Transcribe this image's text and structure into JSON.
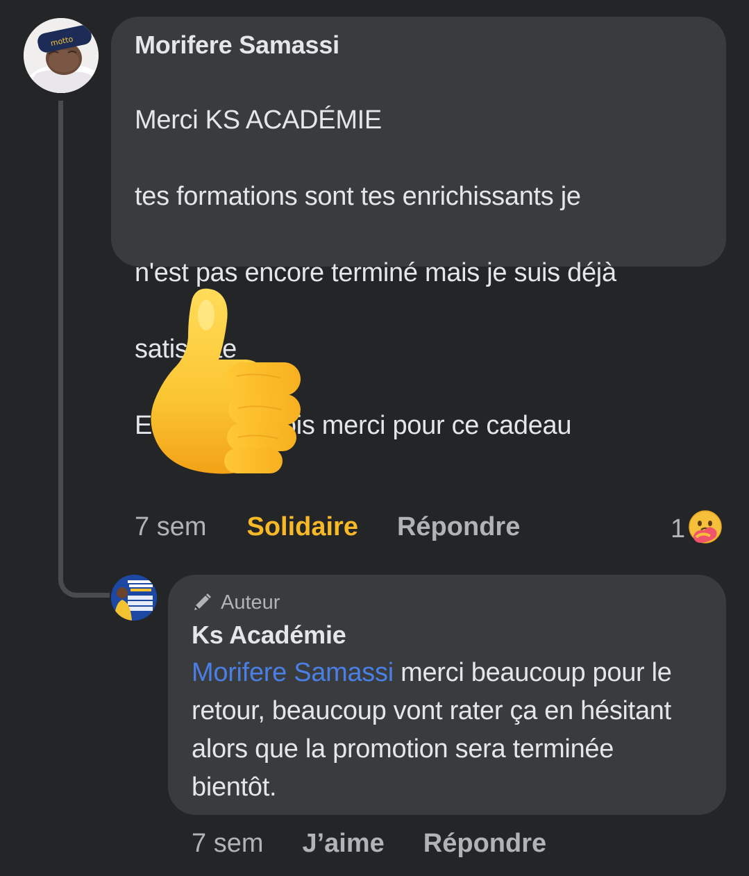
{
  "comment": {
    "author": "Morifere Samassi",
    "lines": [
      "Merci KS ACADÉMIE",
      "tes formations sont tes enrichissants je",
      "n'est pas encore terminé mais je suis déjà",
      "satisfaite",
      "Encore une fois merci pour ce cadeau"
    ],
    "sticker_icon": "thumbs-up-icon",
    "timestamp": "7 sem",
    "reaction_label": "Solidaire",
    "reply_label": "Répondre",
    "reaction_count": "1",
    "reaction_icon": "care-reaction-icon",
    "colors": {
      "reaction_active": "#f7b928"
    }
  },
  "reply": {
    "badge": "Auteur",
    "badge_icon": "pen-icon",
    "author": "Ks Académie",
    "mention": "Morifere Samassi",
    "text_after_mention": " merci beaucoup pour le retour, beaucoup vont rater ça en hésitant alors que la promotion sera terminée bientôt.",
    "timestamp": "7 sem",
    "like_label": "J’aime",
    "reply_label": "Répondre",
    "colors": {
      "mention": "#4a7fe6"
    }
  },
  "theme": {
    "background": "#242526",
    "bubble": "#3a3b3c",
    "primary_text": "#e4e6eb",
    "secondary_text": "#b0b3b8"
  }
}
